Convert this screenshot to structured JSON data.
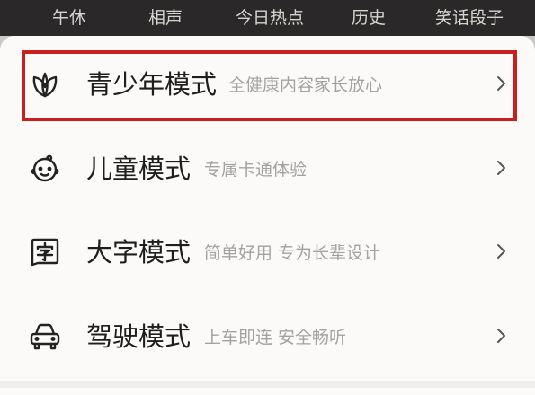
{
  "top_nav": {
    "items": [
      "午休",
      "相声",
      "今日热点",
      "历史",
      "笑话段子"
    ]
  },
  "modes": [
    {
      "title": "青少年模式",
      "description": "全健康内容家长放心",
      "icon": "leaf-icon",
      "highlighted": true
    },
    {
      "title": "儿童模式",
      "description": "专属卡通体验",
      "icon": "child-face-icon",
      "highlighted": false
    },
    {
      "title": "大字模式",
      "description": "简单好用 专为长辈设计",
      "icon": "large-text-icon",
      "highlighted": false
    },
    {
      "title": "驾驶模式",
      "description": "上车即连 安全畅听",
      "icon": "car-icon",
      "highlighted": false
    }
  ],
  "style": {
    "highlight_color": "#c91f1f",
    "title_color": "#1e1e1e",
    "description_color": "#a4a2a0",
    "top_bar_color": "#2a2828",
    "sheet_color": "#fbfaf8"
  }
}
